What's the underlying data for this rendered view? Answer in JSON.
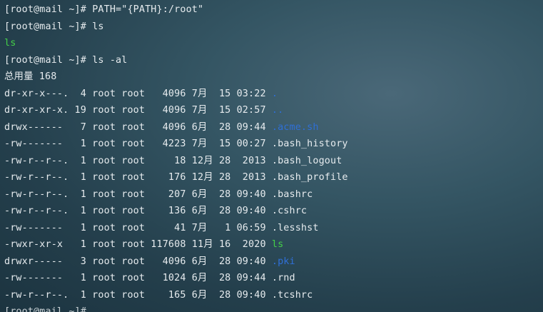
{
  "terminal": {
    "prompt": "[root@mail ~]# ",
    "lines": [
      {
        "type": "command",
        "cmd": "PATH=\"{PATH}:/root\""
      },
      {
        "type": "command",
        "cmd": "ls"
      },
      {
        "type": "exec-output",
        "text": "ls"
      },
      {
        "type": "command",
        "cmd": "ls -al"
      },
      {
        "type": "output",
        "text": "总用量 168"
      },
      {
        "type": "entry",
        "meta": "dr-xr-x---.  4 root root   4096 7月  15 03:22 ",
        "name": ".",
        "kind": "dir"
      },
      {
        "type": "entry",
        "meta": "dr-xr-xr-x. 19 root root   4096 7月  15 02:57 ",
        "name": "..",
        "kind": "dir"
      },
      {
        "type": "entry",
        "meta": "drwx------   7 root root   4096 6月  28 09:44 ",
        "name": ".acme.sh",
        "kind": "dir"
      },
      {
        "type": "entry",
        "meta": "-rw-------   1 root root   4223 7月  15 00:27 ",
        "name": ".bash_history",
        "kind": "file"
      },
      {
        "type": "entry",
        "meta": "-rw-r--r--.  1 root root     18 12月 28  2013 ",
        "name": ".bash_logout",
        "kind": "file"
      },
      {
        "type": "entry",
        "meta": "-rw-r--r--.  1 root root    176 12月 28  2013 ",
        "name": ".bash_profile",
        "kind": "file"
      },
      {
        "type": "entry",
        "meta": "-rw-r--r--.  1 root root    207 6月  28 09:40 ",
        "name": ".bashrc",
        "kind": "file"
      },
      {
        "type": "entry",
        "meta": "-rw-r--r--.  1 root root    136 6月  28 09:40 ",
        "name": ".cshrc",
        "kind": "file"
      },
      {
        "type": "entry",
        "meta": "-rw-------   1 root root     41 7月   1 06:59 ",
        "name": ".lesshst",
        "kind": "file"
      },
      {
        "type": "entry",
        "meta": "-rwxr-xr-x   1 root root 117608 11月 16  2020 ",
        "name": "ls",
        "kind": "exec"
      },
      {
        "type": "entry",
        "meta": "drwxr-----   3 root root   4096 6月  28 09:40 ",
        "name": ".pki",
        "kind": "dir"
      },
      {
        "type": "entry",
        "meta": "-rw-------   1 root root   1024 6月  28 09:44 ",
        "name": ".rnd",
        "kind": "file"
      },
      {
        "type": "entry",
        "meta": "-rw-r--r--.  1 root root    165 6月  28 09:40 ",
        "name": ".tcshrc",
        "kind": "file"
      },
      {
        "type": "command",
        "cmd": ""
      }
    ]
  },
  "colors": {
    "text": "#e6ebee",
    "executable": "#44d048",
    "directory": "#2f6fd6"
  }
}
